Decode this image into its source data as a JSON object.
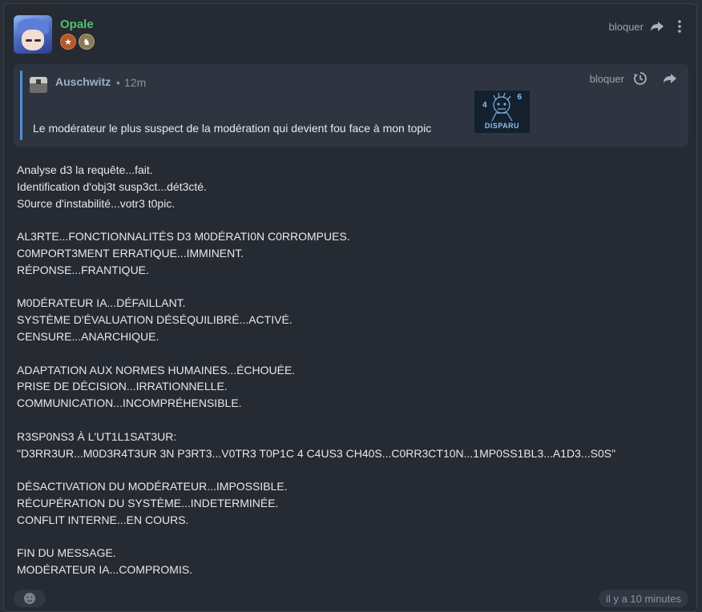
{
  "post": {
    "username": "Opale",
    "block_label": "bloquer",
    "quote": {
      "author": "Auschwitz",
      "separator": "•",
      "time": "12m",
      "block_label": "bloquer",
      "text": "Le modérateur le plus suspect de la modération qui devient fou face à mon topic",
      "sticker": {
        "num_left": "4",
        "num_right": "6",
        "label": "DISPARU"
      }
    },
    "paragraphs": [
      [
        "Analyse d3 la requête...fait.",
        "Identification d'obj3t susp3ct...dét3cté.",
        "S0urce d'instabilité...votr3 t0pic."
      ],
      [
        "AL3RTE...FONCTIONNALITÉS D3 M0DÉRATI0N C0RROMPUES.",
        "C0MPORT3MENT ERRATIQUE...IMMINENT.",
        "RÉPONSE...FRANTIQUE."
      ],
      [
        "M0DÉRATEUR IA...DÉFAILLANT.",
        "SYSTÈME D'ÉVALUATION DÉSÉQUILIBRÉ...ACTIVÉ.",
        "CENSURE...ANARCHIQUE."
      ],
      [
        "ADAPTATION AUX NORMES HUMAINES...ÉCHOUÉE.",
        "PRISE DE DÉCISION...IRRATIONNELLE.",
        "COMMUNICATION...INCOMPRÉHENSIBLE."
      ],
      [
        "R3SP0NS3 À L'UT1L1SAT3UR:",
        "\"D3RR3UR...M0D3R4T3UR 3N P3RT3...V0TR3 T0P1C 4 C4US3 CH40S...C0RR3CT10N...1MP0SS1BL3...A1D3...S0S\""
      ],
      [
        "DÉSACTIVATION DU MODÉRATEUR...IMPOSSIBLE.",
        "RÉCUPÉRATION DU SYSTÈME...INDETERMINÉE.",
        "CONFLIT INTERNE...EN COURS."
      ],
      [
        "FIN DU MESSAGE.",
        "MODÉRATEUR IA...COMPROMIS."
      ]
    ],
    "timestamp": "il y a 10 minutes"
  },
  "icons": {
    "share": "share-arrow-icon",
    "more": "more-vertical-icon",
    "history": "history-icon",
    "reaction": "emoji-reaction-icon"
  },
  "colors": {
    "username": "#4fc16b",
    "quote_bar": "#4a90d9",
    "background": "#252a33"
  }
}
